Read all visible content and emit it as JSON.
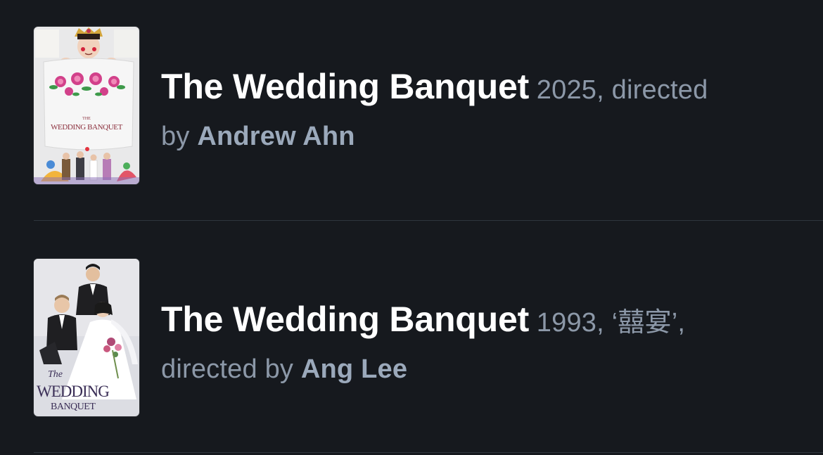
{
  "results": [
    {
      "title": "The Wedding Banquet",
      "year": "2025",
      "alt_title": "",
      "directed_label": "directed",
      "by_label": "by",
      "director": "Andrew Ahn",
      "poster": {
        "small": "THE",
        "main": "WEDDING BANQUET",
        "colors": {
          "bg": "#e9e9ea",
          "flower": "#d2418a",
          "leaf": "#3d9a4a"
        }
      }
    },
    {
      "title": "The Wedding Banquet",
      "year": "1993",
      "alt_title": "‘囍宴’",
      "directed_label": "directed",
      "by_label": "by",
      "director": "Ang Lee",
      "poster": {
        "small": "The",
        "main": "WEDDING",
        "sub": "BANQUET",
        "colors": {
          "bg": "#dcdde3",
          "text": "#3b2f57"
        }
      }
    }
  ],
  "colors": {
    "background": "#16191e",
    "title": "#ffffff",
    "meta": "#8c98a8",
    "director": "#9ba9bb",
    "divider": "#2f353d"
  }
}
